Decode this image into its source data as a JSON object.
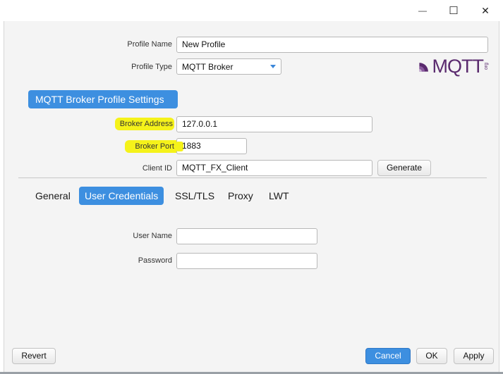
{
  "window": {
    "controls": {
      "minimize": "—",
      "maximize": "☐",
      "close": "✕"
    }
  },
  "profile": {
    "name_label": "Profile Name",
    "name_value": "New Profile",
    "type_label": "Profile Type",
    "type_value": "MQTT Broker"
  },
  "logo": {
    "text": "MQTT",
    "small_text": "org"
  },
  "section": {
    "title": "MQTT Broker Profile Settings"
  },
  "broker": {
    "address_label": "Broker Address",
    "address_value": "127.0.0.1",
    "port_label": "Broker Port",
    "port_value": "1883",
    "client_id_label": "Client ID",
    "client_id_value": "MQTT_FX_Client",
    "generate_label": "Generate"
  },
  "tabs": [
    {
      "label": "General"
    },
    {
      "label": "User Credentials"
    },
    {
      "label": "SSL/TLS"
    },
    {
      "label": "Proxy"
    },
    {
      "label": "LWT"
    }
  ],
  "credentials": {
    "username_label": "User Name",
    "username_value": "",
    "password_label": "Password",
    "password_value": ""
  },
  "footer": {
    "revert_label": "Revert",
    "cancel_label": "Cancel",
    "ok_label": "OK",
    "apply_label": "Apply"
  },
  "colors": {
    "accent": "#3d8fe0",
    "highlight": "#f5f21a",
    "panel": "#f4f4f4",
    "logo": "#5a2a6e"
  }
}
